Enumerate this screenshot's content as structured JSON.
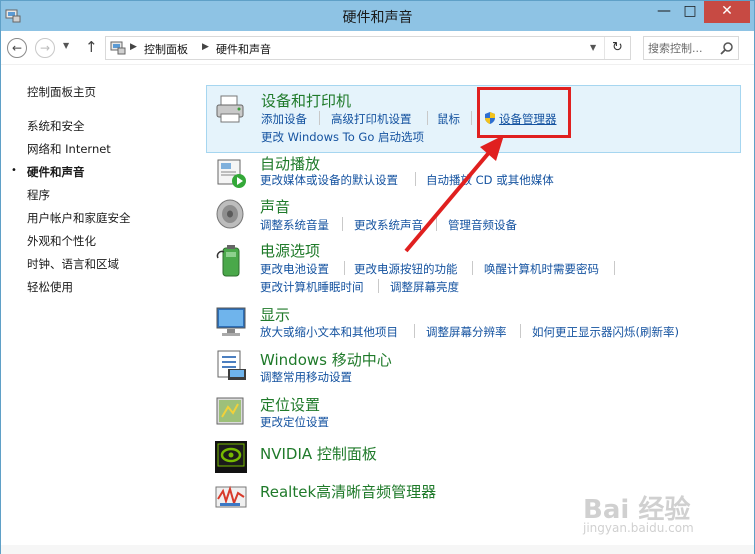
{
  "window": {
    "title": "硬件和声音",
    "controls": {
      "minimize": "—",
      "maximize": "□",
      "close": "✕"
    }
  },
  "navbar": {
    "breadcrumbs": [
      "控制面板",
      "硬件和声音"
    ],
    "breadcrumb_separator": "▶",
    "search_placeholder": "搜索控制...",
    "refresh_icon": "↻"
  },
  "sidebar": {
    "items": [
      {
        "label": "控制面板主页",
        "active": false
      },
      {
        "label": "系统和安全",
        "active": false
      },
      {
        "label": "网络和 Internet",
        "active": false
      },
      {
        "label": "硬件和声音",
        "active": true
      },
      {
        "label": "程序",
        "active": false
      },
      {
        "label": "用户帐户和家庭安全",
        "active": false
      },
      {
        "label": "外观和个性化",
        "active": false
      },
      {
        "label": "时钟、语言和区域",
        "active": false
      },
      {
        "label": "轻松使用",
        "active": false
      }
    ],
    "active_bullet": "•"
  },
  "categories": [
    {
      "title": "设备和打印机",
      "icon": "printer-icon",
      "links": [
        "添加设备",
        "高级打印机设置",
        "鼠标",
        "设备管理器",
        "更改 Windows To Go 启动选项"
      ]
    },
    {
      "title": "自动播放",
      "icon": "autoplay-icon",
      "links": [
        "更改媒体或设备的默认设置",
        "自动播放 CD 或其他媒体"
      ]
    },
    {
      "title": "声音",
      "icon": "speaker-icon",
      "links": [
        "调整系统音量",
        "更改系统声音",
        "管理音频设备"
      ]
    },
    {
      "title": "电源选项",
      "icon": "battery-icon",
      "links": [
        "更改电池设置",
        "更改电源按钮的功能",
        "唤醒计算机时需要密码",
        "更改计算机睡眠时间",
        "调整屏幕亮度"
      ]
    },
    {
      "title": "显示",
      "icon": "display-icon",
      "links": [
        "放大或缩小文本和其他项目",
        "调整屏幕分辨率",
        "如何更正显示器闪烁(刷新率)"
      ]
    },
    {
      "title": "Windows 移动中心",
      "icon": "mobility-center-icon",
      "links": [
        "调整常用移动设置"
      ]
    },
    {
      "title": "定位设置",
      "icon": "location-icon",
      "links": [
        "更改定位设置"
      ]
    },
    {
      "title": "NVIDIA 控制面板",
      "icon": "nvidia-icon",
      "links": []
    },
    {
      "title": "Realtek高清晰音频管理器",
      "icon": "realtek-icon",
      "links": []
    }
  ],
  "watermark": {
    "brand": "Bai 经验",
    "url": "jingyan.baidu.com"
  },
  "colors": {
    "category_title": "#1f7a2a",
    "link": "#1553a0",
    "highlight_bg": "#e5f3fb",
    "annotation": "#e0201f",
    "titlebar": "#8ec3e4",
    "close_button": "#c74a43"
  }
}
